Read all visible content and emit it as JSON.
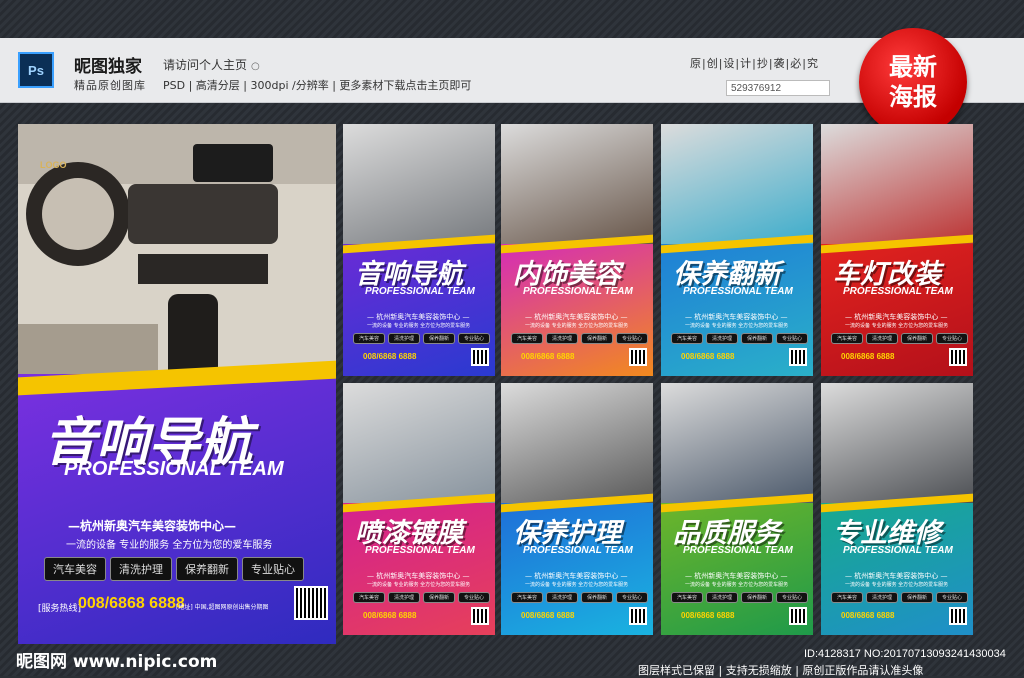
{
  "header": {
    "app_icon": "photoshop-icon",
    "app_icon_text": "Ps",
    "brand_title": "昵图独家",
    "brand_sub": "精品原创图库",
    "visit_link": "请访问个人主页",
    "spec_line": "PSD | 高清分层 | 300dpi /分辨率 | 更多素材下载点击主页即可",
    "original_notice": "原|创|设|计|抄|袭|必|究",
    "id_box": "529376912",
    "badge_line1": "最新",
    "badge_line2": "海报"
  },
  "posters": [
    {
      "id": "big",
      "title": "音响导航",
      "pro": "PROFESSIONAL TEAM",
      "company": "—杭州新奥汽车美容装饰中心—",
      "slogan": "一流的设备 专业的服务 全方位为您的爱车服务",
      "chips": [
        "汽车美容",
        "清洗护理",
        "保养翻新",
        "专业贴心"
      ],
      "hotline_label": "[服务热线]",
      "phone": "008/6868 6888",
      "address": "[地址] 中国,超图网原创出售分期图",
      "qr_label": "二维码",
      "logo": "LOGO",
      "colors": [
        "#6a2bd6",
        "#2a3ad0"
      ]
    },
    {
      "id": "p1",
      "title": "音响导航",
      "pro": "PROFESSIONAL TEAM",
      "company": "— 杭州新奥汽车美容装饰中心 —",
      "slogan": "一流的设备 专业的服务 全方位为您的爱车服务",
      "chips": [
        "汽车美容",
        "清洗护理",
        "保养翻新",
        "专业贴心"
      ],
      "phone": "008/6868 6888",
      "colors": [
        "#6a2bd6",
        "#2a3ad0"
      ]
    },
    {
      "id": "p2",
      "title": "内饰美容",
      "pro": "PROFESSIONAL TEAM",
      "company": "— 杭州新奥汽车美容装饰中心 —",
      "slogan": "一流的设备 专业的服务 全方位为您的爱车服务",
      "chips": [
        "汽车美容",
        "清洗护理",
        "保养翻新",
        "专业贴心"
      ],
      "phone": "008/6868 6888",
      "colors": [
        "#d42cb8",
        "#f28a1e"
      ]
    },
    {
      "id": "p3",
      "title": "保养翻新",
      "pro": "PROFESSIONAL TEAM",
      "company": "— 杭州新奥汽车美容装饰中心 —",
      "slogan": "一流的设备 专业的服务 全方位为您的爱车服务",
      "chips": [
        "汽车美容",
        "清洗护理",
        "保养翻新",
        "专业贴心"
      ],
      "phone": "008/6868 6888",
      "colors": [
        "#1f7fd6",
        "#2ab0c9"
      ]
    },
    {
      "id": "p4",
      "title": "车灯改装",
      "pro": "PROFESSIONAL TEAM",
      "company": "— 杭州新奥汽车美容装饰中心 —",
      "slogan": "一流的设备 专业的服务 全方位为您的爱车服务",
      "chips": [
        "汽车美容",
        "清洗护理",
        "保养翻新",
        "专业贴心"
      ],
      "phone": "008/6868 6888",
      "colors": [
        "#e2231f",
        "#b3101a"
      ]
    },
    {
      "id": "p5",
      "title": "喷漆镀膜",
      "pro": "PROFESSIONAL TEAM",
      "company": "— 杭州新奥汽车美容装饰中心 —",
      "slogan": "一流的设备 专业的服务 全方位为您的爱车服务",
      "chips": [
        "汽车美容",
        "清洗护理",
        "保养翻新",
        "专业贴心"
      ],
      "phone": "008/6868 6888",
      "colors": [
        "#d4218f",
        "#e6405a"
      ]
    },
    {
      "id": "p6",
      "title": "保养护理",
      "pro": "PROFESSIONAL TEAM",
      "company": "— 杭州新奥汽车美容装饰中心 —",
      "slogan": "一流的设备 专业的服务 全方位为您的爱车服务",
      "chips": [
        "汽车美容",
        "清洗护理",
        "保养翻新",
        "专业贴心"
      ],
      "phone": "008/6868 6888",
      "colors": [
        "#1f6fd8",
        "#1ab3e0"
      ]
    },
    {
      "id": "p7",
      "title": "品质服务",
      "pro": "PROFESSIONAL TEAM",
      "company": "— 杭州新奥汽车美容装饰中心 —",
      "slogan": "一流的设备 专业的服务 全方位为您的爱车服务",
      "chips": [
        "汽车美容",
        "清洗护理",
        "保养翻新",
        "专业贴心"
      ],
      "phone": "008/6868 6888",
      "colors": [
        "#6db52a",
        "#1f9a4a"
      ]
    },
    {
      "id": "p8",
      "title": "专业维修",
      "pro": "PROFESSIONAL TEAM",
      "company": "— 杭州新奥汽车美容装饰中心 —",
      "slogan": "一流的设备 专业的服务 全方位为您的爱车服务",
      "chips": [
        "汽车美容",
        "清洗护理",
        "保养翻新",
        "专业贴心"
      ],
      "phone": "008/6868 6888",
      "colors": [
        "#17a98f",
        "#1f8fc9"
      ]
    }
  ],
  "footer": {
    "site": "昵图网 www.nipic.com",
    "id_line": "ID:4128317 NO:20170713093241430034",
    "notice": "图层样式已保留 | 支持无损缩放 | 原创正版作品请认准头像"
  }
}
